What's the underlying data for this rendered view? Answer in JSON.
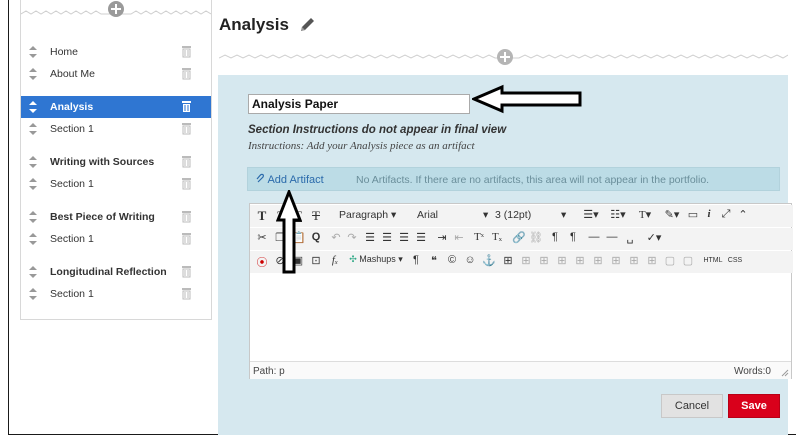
{
  "main": {
    "title": "Analysis",
    "section_title_value": "Analysis Paper",
    "instruction_note": "Section Instructions do not appear in final view",
    "instructions": "Instructions: Add your Analysis piece as an artifact",
    "add_artifact_label": "Add Artifact",
    "artifact_note": "No Artifacts. If there are no artifacts, this area will not appear in the portfolio."
  },
  "sidebar": {
    "items": [
      {
        "label": "Home",
        "bold": false,
        "active": false
      },
      {
        "label": "About Me",
        "bold": false,
        "active": false
      },
      {
        "label": "Analysis",
        "bold": true,
        "active": true
      },
      {
        "label": "Section 1",
        "bold": false,
        "active": false
      },
      {
        "label": "Writing with Sources",
        "bold": true,
        "active": false
      },
      {
        "label": "Section 1",
        "bold": false,
        "active": false
      },
      {
        "label": "Best Piece of Writing",
        "bold": true,
        "active": false
      },
      {
        "label": "Section 1",
        "bold": false,
        "active": false
      },
      {
        "label": "Longitudinal Reflection",
        "bold": true,
        "active": false
      },
      {
        "label": "Section 1",
        "bold": false,
        "active": false
      }
    ]
  },
  "editor": {
    "format_select": "Paragraph",
    "font_select": "Arial",
    "size_select": "3 (12pt)",
    "mashups_label": "Mashups",
    "html_label": "HTML",
    "css_label": "CSS",
    "path_label": "Path: p",
    "words_label": "Words:0"
  },
  "actions": {
    "cancel_label": "Cancel",
    "save_label": "Save"
  },
  "colors": {
    "active_item": "#2f76d2",
    "panel": "#d6e8ef",
    "artifact_bar": "#bcdce6",
    "save_button": "#d9001b",
    "link": "#2a6aab"
  }
}
